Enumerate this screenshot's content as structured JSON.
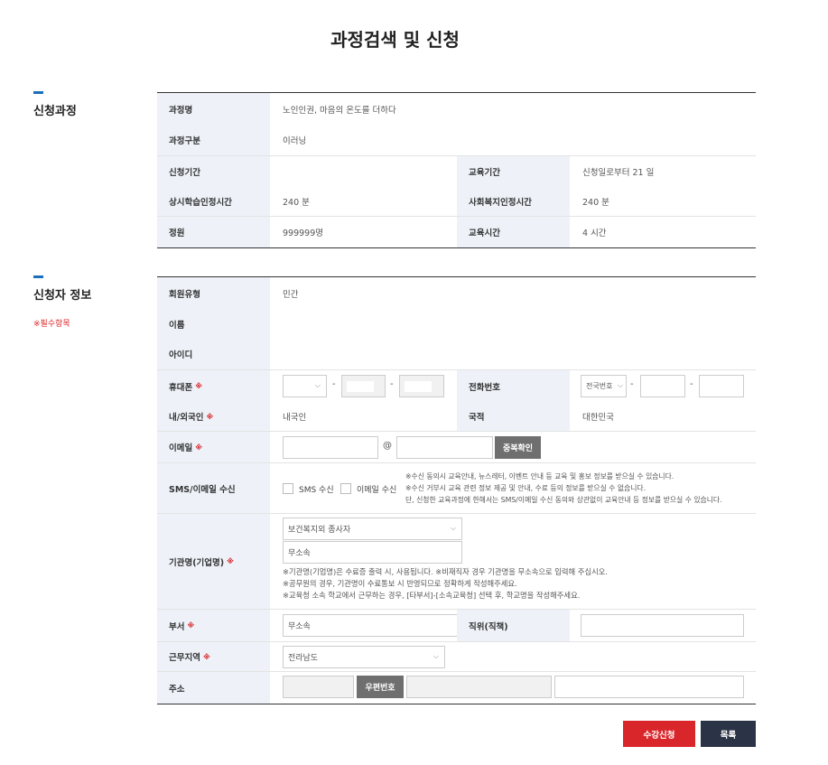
{
  "page": {
    "title": "과정검색 및 신청"
  },
  "course_section": {
    "title": "신청과정",
    "rows": {
      "name_label": "과정명",
      "name_value": "노인인권, 마음의 온도를 더하다",
      "type_label": "과정구분",
      "type_value": "이러닝",
      "apply_period_label": "신청기간",
      "apply_period_value": "",
      "edu_period_label": "교육기간",
      "edu_period_value": "신청일로부터 21 일",
      "sangsi_label": "상시학습인정시간",
      "sangsi_value": "240 분",
      "social_label": "사회복지인정시간",
      "social_value": "240 분",
      "capacity_label": "정원",
      "capacity_value": "999999명",
      "edu_time_label": "교육시간",
      "edu_time_value": "4 시간"
    }
  },
  "applicant_section": {
    "title": "신청자 정보",
    "required_note": "※필수항목",
    "required_mark": "※",
    "member_type_label": "회원유형",
    "member_type_value": "민간",
    "name_label": "이름",
    "name_value": "",
    "id_label": "아이디",
    "id_value": "",
    "phone_label": "휴대폰",
    "phone_dash": "-",
    "tel_label": "전화번호",
    "tel_area_select": "전국번호",
    "nationality_label": "내/외국인",
    "nationality_value": "내국인",
    "country_label": "국적",
    "country_value": "대한민국",
    "email_label": "이메일",
    "email_at": "@",
    "email_check_button": "중복확인",
    "sms_label": "SMS/이메일 수신",
    "sms_checkbox": "SMS 수신",
    "email_checkbox": "이메일 수신",
    "sms_notes": [
      "※수신 동의시 교육안내, 뉴스레터, 이벤트 안내 등 교육 및 홍보 정보를 받으실 수 있습니다.",
      "※수신 거부시 교육 관련 정보 제공 및 안내, 수료 등의 정보를 받으실 수 없습니다.",
      "단, 신청한 교육과정에 한해서는 SMS/이메일 수신 동의와 상관없이 교육안내 등 정보를 받으실 수 있습니다."
    ],
    "org_label": "기관명(기업명)",
    "org_select": "보건복지외 종사자",
    "org_input": "무소속",
    "org_notes": [
      "※기관명(기업명)은 수료증 출력 시, 사용됩니다. ※비재직자 경우 기관명을 무소속으로 입력해 주십시오.",
      "※공무원의 경우, 기관명이 수료통보 시 반영되므로 정확하게 작성해주세요.",
      "※교육청 소속 학교에서 근무하는 경우, [타부서]-[소속교육청] 선택 후, 학교명을 작성해주세요."
    ],
    "dept_label": "부서",
    "dept_value": "무소속",
    "position_label": "직위(직책)",
    "position_value": "",
    "region_label": "근무지역",
    "region_select": "전라남도",
    "address_label": "주소",
    "zipcode_button": "우편번호"
  },
  "actions": {
    "apply_button": "수강신청",
    "list_button": "목록"
  },
  "colors": {
    "accent_blue": "#1c6fb8",
    "header_bg": "#eef2f8",
    "apply_red": "#d9262b",
    "list_navy": "#2b3447",
    "gray_button": "#6f6f6f"
  }
}
